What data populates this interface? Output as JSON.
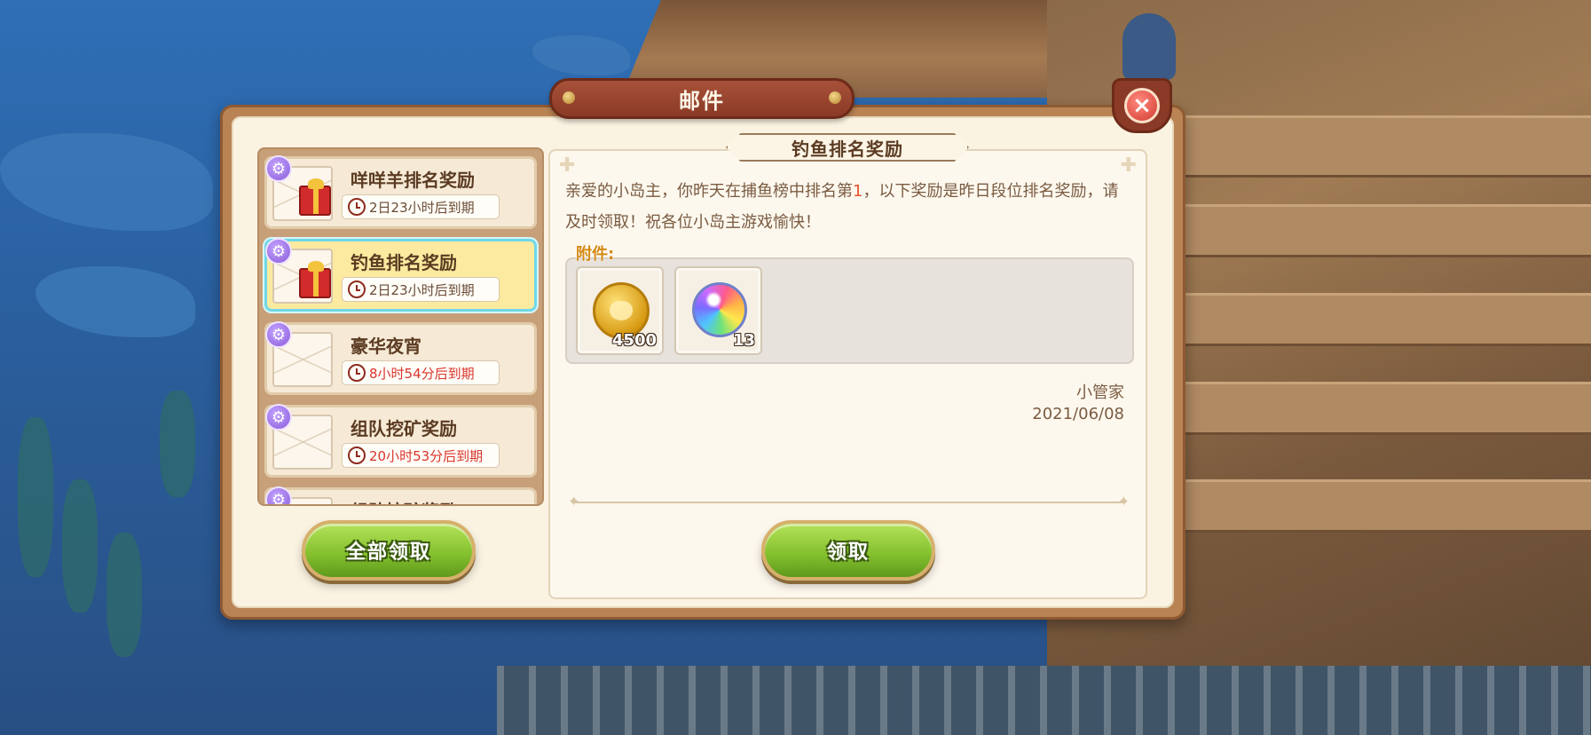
{
  "dialog": {
    "title": "邮件",
    "close_icon": "close-icon"
  },
  "mail_list": {
    "items": [
      {
        "title": "咩咩羊排名奖励",
        "expiry": "2日23小时后到期",
        "urgent": false,
        "has_gift": true,
        "selected": false
      },
      {
        "title": "钓鱼排名奖励",
        "expiry": "2日23小时后到期",
        "urgent": false,
        "has_gift": true,
        "selected": true
      },
      {
        "title": "豪华夜宵",
        "expiry": "8小时54分后到期",
        "urgent": true,
        "has_gift": false,
        "selected": false
      },
      {
        "title": "组队挖矿奖励",
        "expiry": "20小时53分后到期",
        "urgent": true,
        "has_gift": false,
        "selected": false
      },
      {
        "title": "组队挖矿奖励",
        "expiry": "",
        "urgent": false,
        "has_gift": false,
        "selected": false
      }
    ]
  },
  "detail": {
    "title": "钓鱼排名奖励",
    "body_before": "亲爱的小岛主，你昨天在捕鱼榜中排名第",
    "rank": "1",
    "body_after": "，以下奖励是昨日段位排名奖励，请及时领取！祝各位小岛主游戏愉快！",
    "attachment_label": "附件:",
    "attachments": [
      {
        "icon": "gold-coin-icon",
        "count": "4500"
      },
      {
        "icon": "rainbow-orb-icon",
        "count": "13"
      }
    ],
    "sender": "小管家",
    "date": "2021/06/08"
  },
  "buttons": {
    "claim_all": "全部领取",
    "claim": "领取"
  },
  "colors": {
    "highlight": "#e5532a",
    "urgent": "#d9352d",
    "button_green": "#86c22f",
    "selected_border": "#6fd8e8"
  }
}
